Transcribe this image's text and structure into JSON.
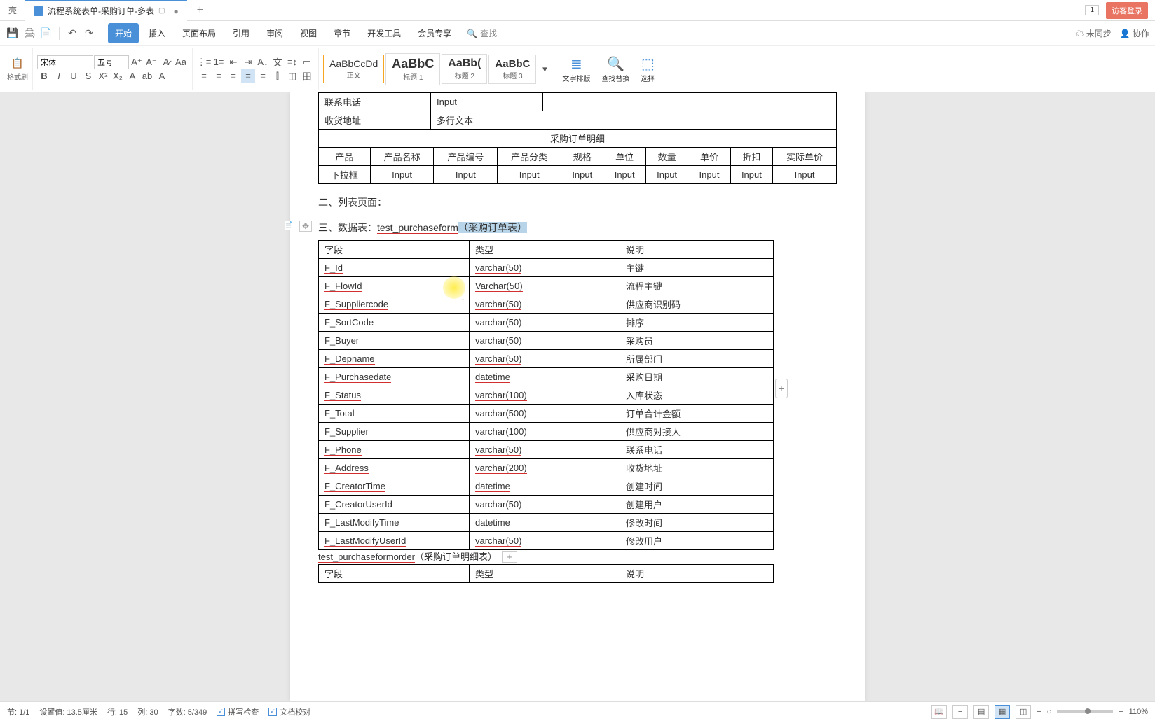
{
  "titlebar": {
    "tab_inactive": "壳",
    "tab_active": "流程系统表单-采购订单-多表",
    "page_indicator": "1",
    "login": "访客登录"
  },
  "toolbar1": {
    "tabs": [
      "开始",
      "插入",
      "页面布局",
      "引用",
      "审阅",
      "视图",
      "章节",
      "开发工具",
      "会员专享"
    ],
    "search": "查找",
    "sync": "未同步",
    "collab": "协作"
  },
  "ribbon": {
    "format_painter": "格式刷",
    "font_name": "宋体",
    "font_size": "五号",
    "styles": [
      {
        "preview": "AaBbCcDd",
        "name": "正文"
      },
      {
        "preview": "AaBbC",
        "name": "标题 1"
      },
      {
        "preview": "AaBb(",
        "name": "标题 2"
      },
      {
        "preview": "AaBbC",
        "name": "标题 3"
      }
    ],
    "layout": "文字排版",
    "find_replace": "查找替换",
    "select": "选择"
  },
  "document": {
    "top_table": {
      "row1": [
        "联系电话",
        "Input"
      ],
      "row2": [
        "收货地址",
        "多行文本"
      ],
      "detail_header": "采购订单明细",
      "headers": [
        "产品",
        "产品名称",
        "产品编号",
        "产品分类",
        "规格",
        "单位",
        "数量",
        "单价",
        "折扣",
        "实际单价"
      ],
      "row3": [
        "下拉框",
        "Input",
        "Input",
        "Input",
        "Input",
        "Input",
        "Input",
        "Input",
        "Input",
        "Input"
      ]
    },
    "section2": "二、列表页面：",
    "section3_prefix": "三、数据表：",
    "section3_table": "test_purchaseform",
    "section3_suffix": "（采购订单表）",
    "db_table": {
      "headers": [
        "字段",
        "类型",
        "说明"
      ],
      "rows": [
        [
          "F_Id",
          "varchar(50)",
          "主键"
        ],
        [
          "F_FlowId",
          "Varchar(50)",
          "流程主键"
        ],
        [
          "F_Suppliercode",
          "varchar(50)",
          "供应商识别码"
        ],
        [
          "F_SortCode",
          "varchar(50)",
          "排序"
        ],
        [
          "F_Buyer",
          "varchar(50)",
          "采购员"
        ],
        [
          "F_Depname",
          "varchar(50)",
          "所属部门"
        ],
        [
          "F_Purchasedate",
          "datetime",
          "采购日期"
        ],
        [
          "F_Status",
          "varchar(100)",
          "入库状态"
        ],
        [
          "F_Total",
          "varchar(500)",
          "订单合计金额"
        ],
        [
          "F_Supplier",
          "varchar(100)",
          "供应商对接人"
        ],
        [
          "F_Phone",
          "varchar(50)",
          "联系电话"
        ],
        [
          "F_Address",
          "varchar(200)",
          "收货地址"
        ],
        [
          "F_CreatorTime",
          "datetime",
          "创建时间"
        ],
        [
          "F_CreatorUserId",
          "varchar(50)",
          "创建用户"
        ],
        [
          "F_LastModifyTime",
          "datetime",
          "修改时间"
        ],
        [
          "F_LastModifyUserId",
          "varchar(50)",
          "修改用户"
        ]
      ]
    },
    "sub_table_name": "test_purchaseformorder",
    "sub_table_suffix": "（采购订单明细表）",
    "sub_headers": [
      "字段",
      "类型",
      "说明"
    ]
  },
  "statusbar": {
    "section": "节: 1/1",
    "setval": "设置值: 13.5厘米",
    "row": "行: 15",
    "col": "列: 30",
    "words": "字数: 5/349",
    "spellcheck": "拼写检查",
    "doccheck": "文档校对",
    "zoom": "110%"
  }
}
